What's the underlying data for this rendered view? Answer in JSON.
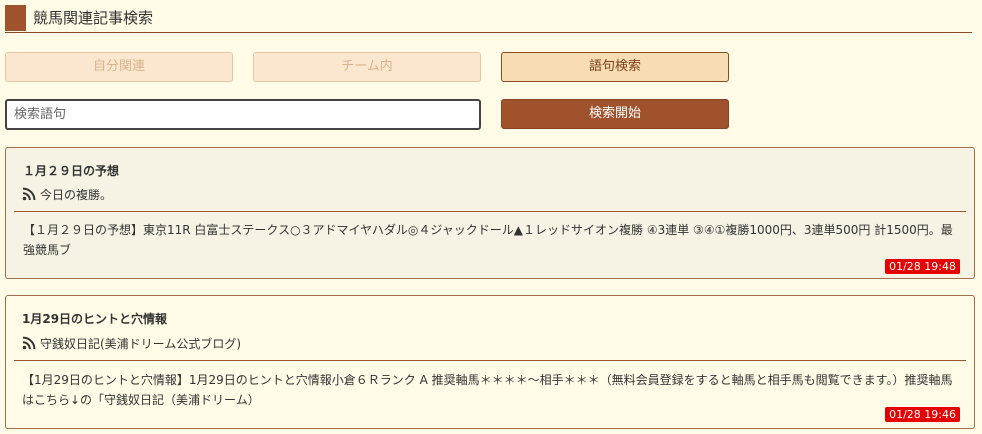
{
  "header": {
    "title": "競馬関連記事検索",
    "accent_color": "#a0522d"
  },
  "tabs": [
    {
      "label": "自分関連",
      "state": "disabled"
    },
    {
      "label": "チーム内",
      "state": "disabled"
    },
    {
      "label": "語句検索",
      "state": "selected"
    }
  ],
  "search": {
    "placeholder": "検索語句",
    "value": "",
    "button_label": "検索開始"
  },
  "articles": [
    {
      "title": "１月２９日の予想",
      "source_icon": "rss-icon",
      "source": "今日の複勝。",
      "body": "【１月２９日の予想】東京11R 白富士ステークス○３アドマイヤハダル◎４ジャックドール▲１レッドサイオン複勝 ④3連単 ③④①複勝1000円、3連単500円 計1500円。最強競馬ブ",
      "timestamp": "01/28 19:48"
    },
    {
      "title": "1月29日のヒントと穴情報",
      "source_icon": "rss-icon",
      "source": "守銭奴日記(美浦ドリーム公式ブログ)",
      "body": "【1月29日のヒントと穴情報】1月29日のヒントと穴情報小倉６Ｒランク A 推奨軸馬＊＊＊＊〜相手＊＊＊（無料会員登録をすると軸馬と相手馬も閲覧できます。）推奨軸馬はこちら↓の「守銭奴日記（美浦ドリーム）",
      "timestamp": "01/28 19:46"
    }
  ],
  "colors": {
    "brand": "#a0522d",
    "badge": "#e60000",
    "page_bg": "#fffbe6"
  }
}
